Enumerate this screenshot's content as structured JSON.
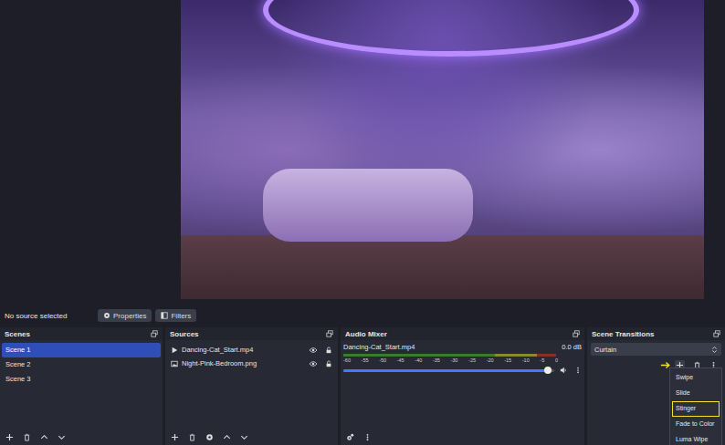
{
  "properties_bar": {
    "status": "No source selected",
    "buttons": [
      {
        "label": "Properties",
        "kind": "gear"
      },
      {
        "label": "Filters",
        "kind": "filter"
      }
    ]
  },
  "scenes": {
    "title": "Scenes",
    "items": [
      {
        "label": "Scene 1",
        "selected": true
      },
      {
        "label": "Scene 2",
        "selected": false
      },
      {
        "label": "Scene 3",
        "selected": false
      }
    ]
  },
  "sources": {
    "title": "Sources",
    "items": [
      {
        "label": "Dancing-Cat_Start.mp4",
        "kind": "media",
        "visible": true,
        "locked": false
      },
      {
        "label": "Night-Pink-Bedroom.png",
        "kind": "image",
        "visible": true,
        "locked": false
      }
    ]
  },
  "audio_mixer": {
    "title": "Audio Mixer",
    "scale": [
      "-60",
      "-55",
      "-50",
      "-45",
      "-40",
      "-35",
      "-30",
      "-25",
      "-20",
      "-15",
      "-10",
      "-5",
      "0"
    ],
    "channels": [
      {
        "name": "Dancing-Cat_Start.mp4",
        "reading": "0.0 dB",
        "level": 0.97,
        "muted": false
      }
    ]
  },
  "transitions": {
    "title": "Scene Transitions",
    "selected": "Curtain",
    "menu": [
      {
        "label": "Swipe",
        "highlighted": false
      },
      {
        "label": "Slide",
        "highlighted": false
      },
      {
        "label": "Stinger",
        "highlighted": true
      },
      {
        "label": "Fade to Color",
        "highlighted": false
      },
      {
        "label": "Luma Wipe",
        "highlighted": false
      }
    ]
  }
}
